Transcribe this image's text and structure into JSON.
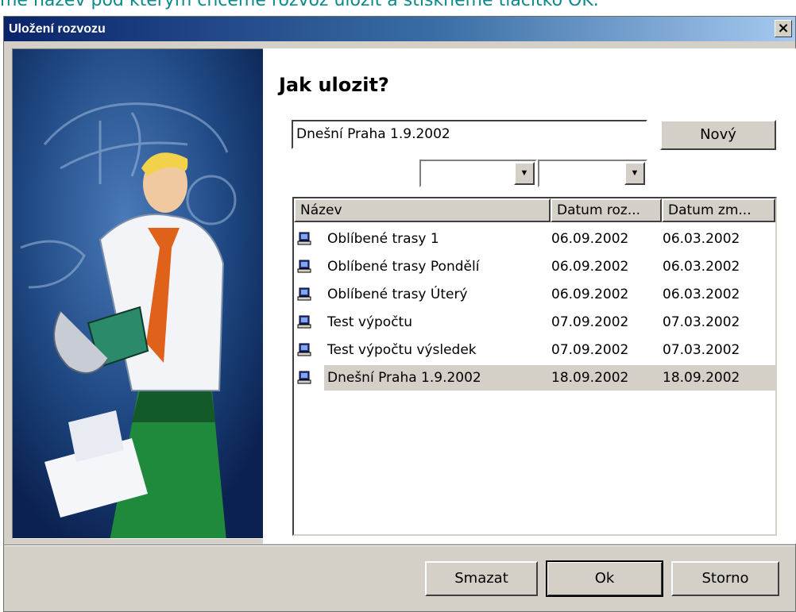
{
  "background_caption": "me název pod kterým chceme rozvoz uložit a stiskneme tlačítko OK.",
  "window": {
    "title": "Uložení rozvozu",
    "close_glyph": "×"
  },
  "heading": "Jak ulozit?",
  "name_field": {
    "value": "Dnešní Praha 1.9.2002"
  },
  "new_button": "Nový",
  "combo_arrow": "▼",
  "list": {
    "columns": [
      "Název",
      "Datum roz...",
      "Datum zm..."
    ],
    "rows": [
      {
        "name": "Oblíbené trasy 1",
        "date_created": "06.09.2002",
        "date_modified": "06.03.2002",
        "selected": false
      },
      {
        "name": "Oblíbené trasy Pondělí",
        "date_created": "06.09.2002",
        "date_modified": "06.03.2002",
        "selected": false
      },
      {
        "name": "Oblíbené trasy Úterý",
        "date_created": "06.09.2002",
        "date_modified": "06.03.2002",
        "selected": false
      },
      {
        "name": "Test výpočtu",
        "date_created": "07.09.2002",
        "date_modified": "07.03.2002",
        "selected": false
      },
      {
        "name": "Test výpočtu výsledek",
        "date_created": "07.09.2002",
        "date_modified": "07.03.2002",
        "selected": false
      },
      {
        "name": "Dnešní Praha 1.9.2002",
        "date_created": "18.09.2002",
        "date_modified": "18.09.2002",
        "selected": true
      }
    ]
  },
  "buttons": {
    "delete": "Smazat",
    "ok": "Ok",
    "cancel": "Storno"
  },
  "icons": {
    "row": "computer-icon",
    "illustration": "man-reading-book-illustration"
  },
  "colors": {
    "title_start": "#0a246a",
    "title_end": "#a6caf0",
    "panel": "#0e2a5a",
    "caption": "#0a8a8a"
  }
}
